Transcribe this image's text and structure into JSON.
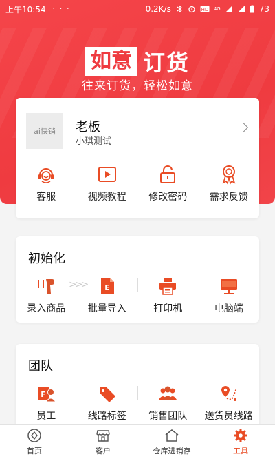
{
  "status_bar": {
    "time": "上午10:54",
    "dots": "· · ·",
    "net_speed": "0.2K/s",
    "network": "4G",
    "battery": "73"
  },
  "hero": {
    "title_highlight": "如意",
    "title_rest": "订货",
    "subtitle": "往来订货，轻松如意"
  },
  "profile": {
    "avatar_text": "ai快销",
    "name": "老板",
    "sub": "小琪测试",
    "actions": [
      {
        "label": "客服",
        "icon": "headset-icon"
      },
      {
        "label": "视频教程",
        "icon": "video-play-icon"
      },
      {
        "label": "修改密码",
        "icon": "lock-icon"
      },
      {
        "label": "需求反馈",
        "icon": "award-ribbon-icon"
      }
    ]
  },
  "init_section": {
    "title": "初始化",
    "items": [
      {
        "label": "录入商品",
        "icon": "barcode-scanner-icon"
      },
      {
        "label": "批量导入",
        "icon": "excel-file-icon"
      },
      {
        "label": "打印机",
        "icon": "printer-icon"
      },
      {
        "label": "电脑端",
        "icon": "monitor-icon"
      }
    ],
    "arrow_text": ">>>"
  },
  "team_section": {
    "title": "团队",
    "items": [
      {
        "label": "员工",
        "icon": "employee-card-icon"
      },
      {
        "label": "线路标签",
        "icon": "tag-icon"
      },
      {
        "label": "销售团队",
        "icon": "group-icon"
      },
      {
        "label": "送货员线路",
        "icon": "route-pin-icon"
      }
    ]
  },
  "tabbar": {
    "tabs": [
      {
        "label": "首页",
        "icon": "home-diamond-icon",
        "active": false
      },
      {
        "label": "客户",
        "icon": "store-icon",
        "active": false
      },
      {
        "label": "仓库进销存",
        "icon": "warehouse-icon",
        "active": false
      },
      {
        "label": "工具",
        "icon": "gear-icon",
        "active": true
      }
    ]
  },
  "colors": {
    "brand_red": "#ef3b40",
    "accent_orange": "#e94c25"
  }
}
